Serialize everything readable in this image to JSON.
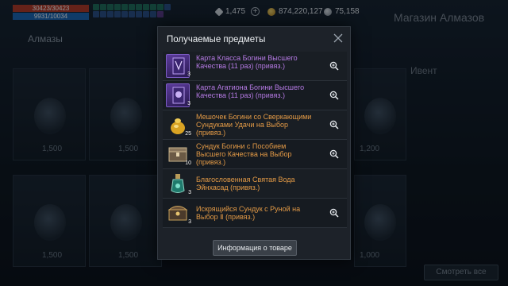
{
  "player": {
    "hp": "30423/30423",
    "mp": "9931/10034"
  },
  "currencies": [
    {
      "icon": "diamond-icon",
      "value": "1,475",
      "color": "#d7dde4"
    },
    {
      "icon": "gold-coin-icon",
      "value": "874,220,127",
      "color": "#e0b23a"
    },
    {
      "icon": "silver-coin-icon",
      "value": "75,158",
      "color": "#b9c1c9"
    }
  ],
  "background": {
    "shop_title": "Магазин Алмазов",
    "left_title": "Алмазы",
    "side_label": "Ивент",
    "prices": [
      "1,500",
      "1,500",
      "1,500",
      "1,200",
      "1,500",
      "1,500",
      "1,500",
      "1,000"
    ],
    "bottom_button": "Смотреть все"
  },
  "modal": {
    "title": "Получаемые предметы",
    "items": [
      {
        "name": "Карта Класса Богини Высшего Качества (11 раз) (привяз.)",
        "qty": "3",
        "rarity": "purple",
        "icon": "goddess-card-icon"
      },
      {
        "name": "Карта Агатиона Богини Высшего Качества (11 раз) (привяз.)",
        "qty": "3",
        "rarity": "purple",
        "icon": "agathion-card-icon"
      },
      {
        "name": "Мешочек Богини со Сверкающими Сундуками Удачи на Выбор (привяз.)",
        "qty": "25",
        "rarity": "orange",
        "icon": "gold-pouch-icon"
      },
      {
        "name": "Сундук Богини с Пособием Высшего Качества на Выбор (привяз.)",
        "qty": "10",
        "rarity": "orange",
        "icon": "chest-icon"
      },
      {
        "name": "Благословенная Святая Вода Эйнхасад (привяз.)",
        "qty": "3",
        "rarity": "orange",
        "icon": "holy-water-icon"
      },
      {
        "name": "Искрящийся Сундук с Руной на Выбор Ⅱ (привяз.)",
        "qty": "3",
        "rarity": "orange",
        "icon": "rune-chest-icon"
      }
    ],
    "info_button": "Информация о товаре"
  }
}
